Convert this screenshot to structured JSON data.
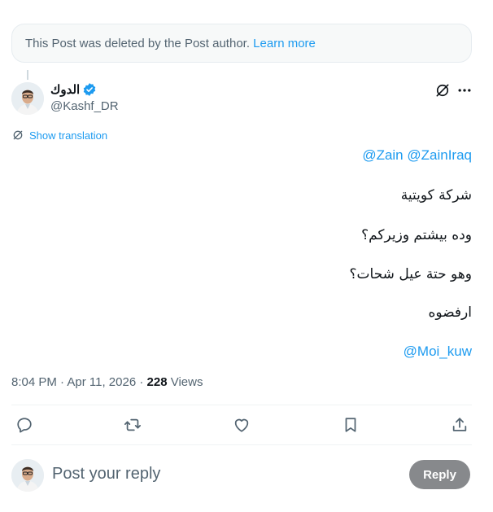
{
  "deleted_notice": {
    "text": "This Post was deleted by the Post author.",
    "link": "Learn more"
  },
  "author": {
    "name": "الدوك",
    "handle": "@Kashf_DR",
    "verified_icon": "verified-badge-icon",
    "verified_color": "#1d9bf0"
  },
  "translation_label": "Show translation",
  "post": {
    "mention_line": [
      "@Zain",
      "@ZainIraq"
    ],
    "lines": [
      "شركة كويتية",
      "وده بيشتم وزيركم؟",
      "وهو حتة عيل شحات؟",
      "ارفضوه"
    ],
    "final_mention": "@Moi_kuw"
  },
  "meta": {
    "time": "8:04 PM",
    "date": "Apr 11, 2026",
    "views_count": "228",
    "views_label": "Views"
  },
  "actions": [
    "reply-icon",
    "repost-icon",
    "like-icon",
    "bookmark-icon",
    "share-icon"
  ],
  "reply_box": {
    "placeholder": "Post your reply",
    "button": "Reply"
  },
  "colors": {
    "accent": "#1d9bf0",
    "secondary_text": "#536471",
    "reply_button_disabled": "#87898c"
  }
}
